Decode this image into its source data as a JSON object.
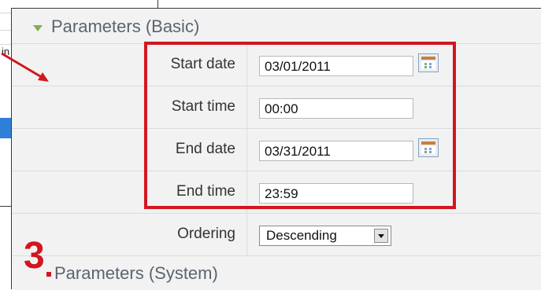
{
  "background_window": {
    "truncated_text": "in"
  },
  "panel": {
    "basic_title": "Parameters (Basic)",
    "system_title": "Parameters (System)",
    "rows": {
      "start_date": {
        "label": "Start date",
        "value": "03/01/2011"
      },
      "start_time": {
        "label": "Start time",
        "value": "00:00"
      },
      "end_date": {
        "label": "End date",
        "value": "03/31/2011"
      },
      "end_time": {
        "label": "End time",
        "value": "23:59"
      },
      "ordering": {
        "label": "Ordering",
        "value": "Descending"
      }
    }
  },
  "annotation": {
    "step_number": "3"
  },
  "colors": {
    "annotation_red": "#d2161e",
    "panel_bg": "#f2f2f2",
    "title_gray": "#5b6470",
    "triangle_green": "#7fb050"
  },
  "icons": {
    "expand": "triangle-down-icon",
    "calendar": "calendar-icon",
    "dropdown": "chevron-down-icon",
    "arrow": "arrow-icon"
  }
}
